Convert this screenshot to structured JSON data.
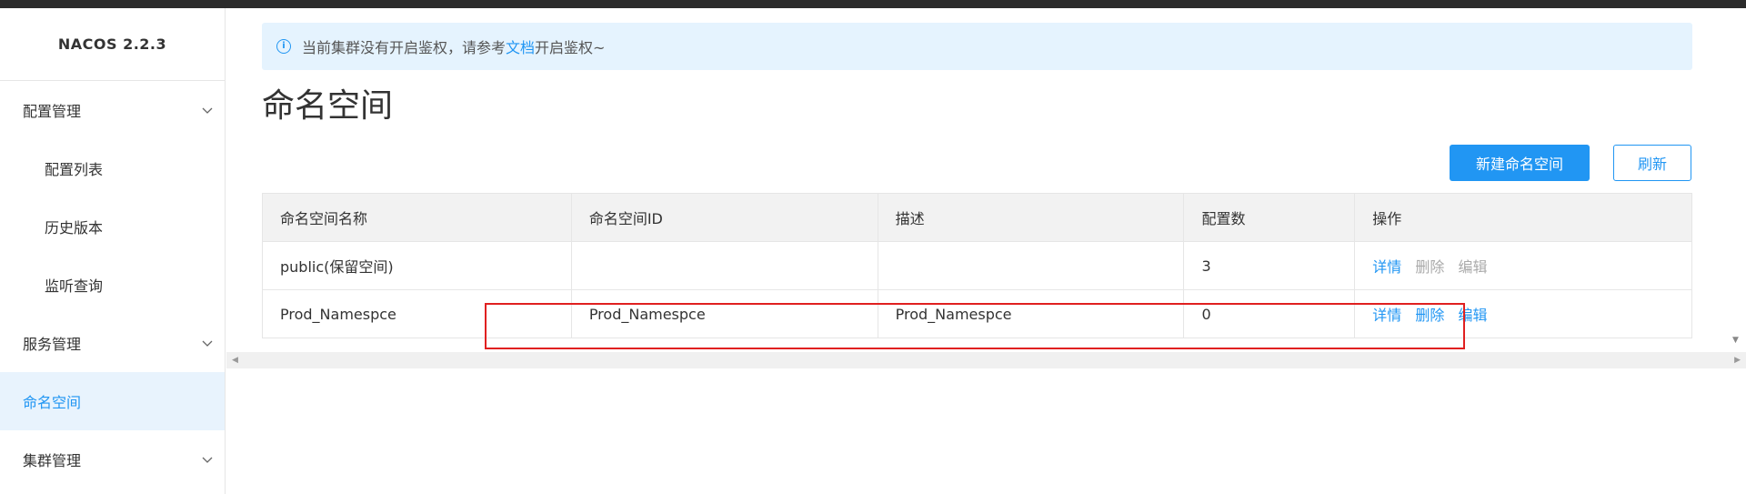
{
  "app": {
    "brand": "NACOS 2.2.3"
  },
  "sidebar": {
    "groups": [
      {
        "label": "配置管理"
      },
      {
        "label": "服务管理"
      },
      {
        "label": "集群管理"
      }
    ],
    "config_items": [
      {
        "label": "配置列表"
      },
      {
        "label": "历史版本"
      },
      {
        "label": "监听查询"
      }
    ],
    "active_item": {
      "label": "命名空间"
    }
  },
  "alert": {
    "text_before": "当前集群没有开启鉴权，请参考",
    "link": "文档",
    "text_after": "开启鉴权~"
  },
  "page": {
    "title": "命名空间"
  },
  "toolbar": {
    "create_label": "新建命名空间",
    "refresh_label": "刷新"
  },
  "table": {
    "headers": [
      "命名空间名称",
      "命名空间ID",
      "描述",
      "配置数",
      "操作"
    ],
    "rows": [
      {
        "name": "public(保留空间)",
        "id": "",
        "desc": "",
        "count": "3",
        "ops": [
          "详情",
          "删除",
          "编辑"
        ],
        "ops_enabled": [
          true,
          false,
          false
        ]
      },
      {
        "name": "Prod_Namespce",
        "id": "Prod_Namespce",
        "desc": "Prod_Namespce",
        "count": "0",
        "ops": [
          "详情",
          "删除",
          "编辑"
        ],
        "ops_enabled": [
          true,
          true,
          true
        ]
      }
    ]
  },
  "colors": {
    "accent": "#2196f3",
    "highlight": "#e02020",
    "alert_bg": "#e5f3fe"
  }
}
